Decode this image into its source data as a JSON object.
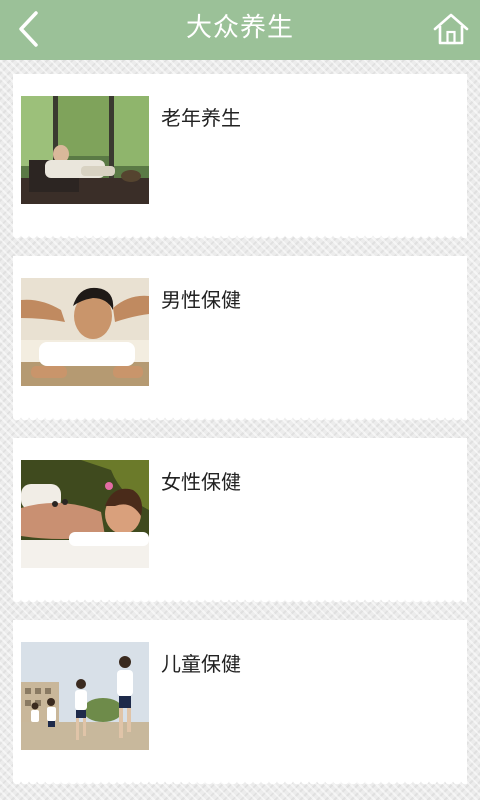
{
  "header": {
    "title": "大众养生",
    "back_icon": "chevron-left-icon",
    "home_icon": "home-icon",
    "bg_color": "#9bc198"
  },
  "items": [
    {
      "label": "老年养生"
    },
    {
      "label": "男性保健"
    },
    {
      "label": "女性保健"
    },
    {
      "label": "儿童保健"
    }
  ]
}
